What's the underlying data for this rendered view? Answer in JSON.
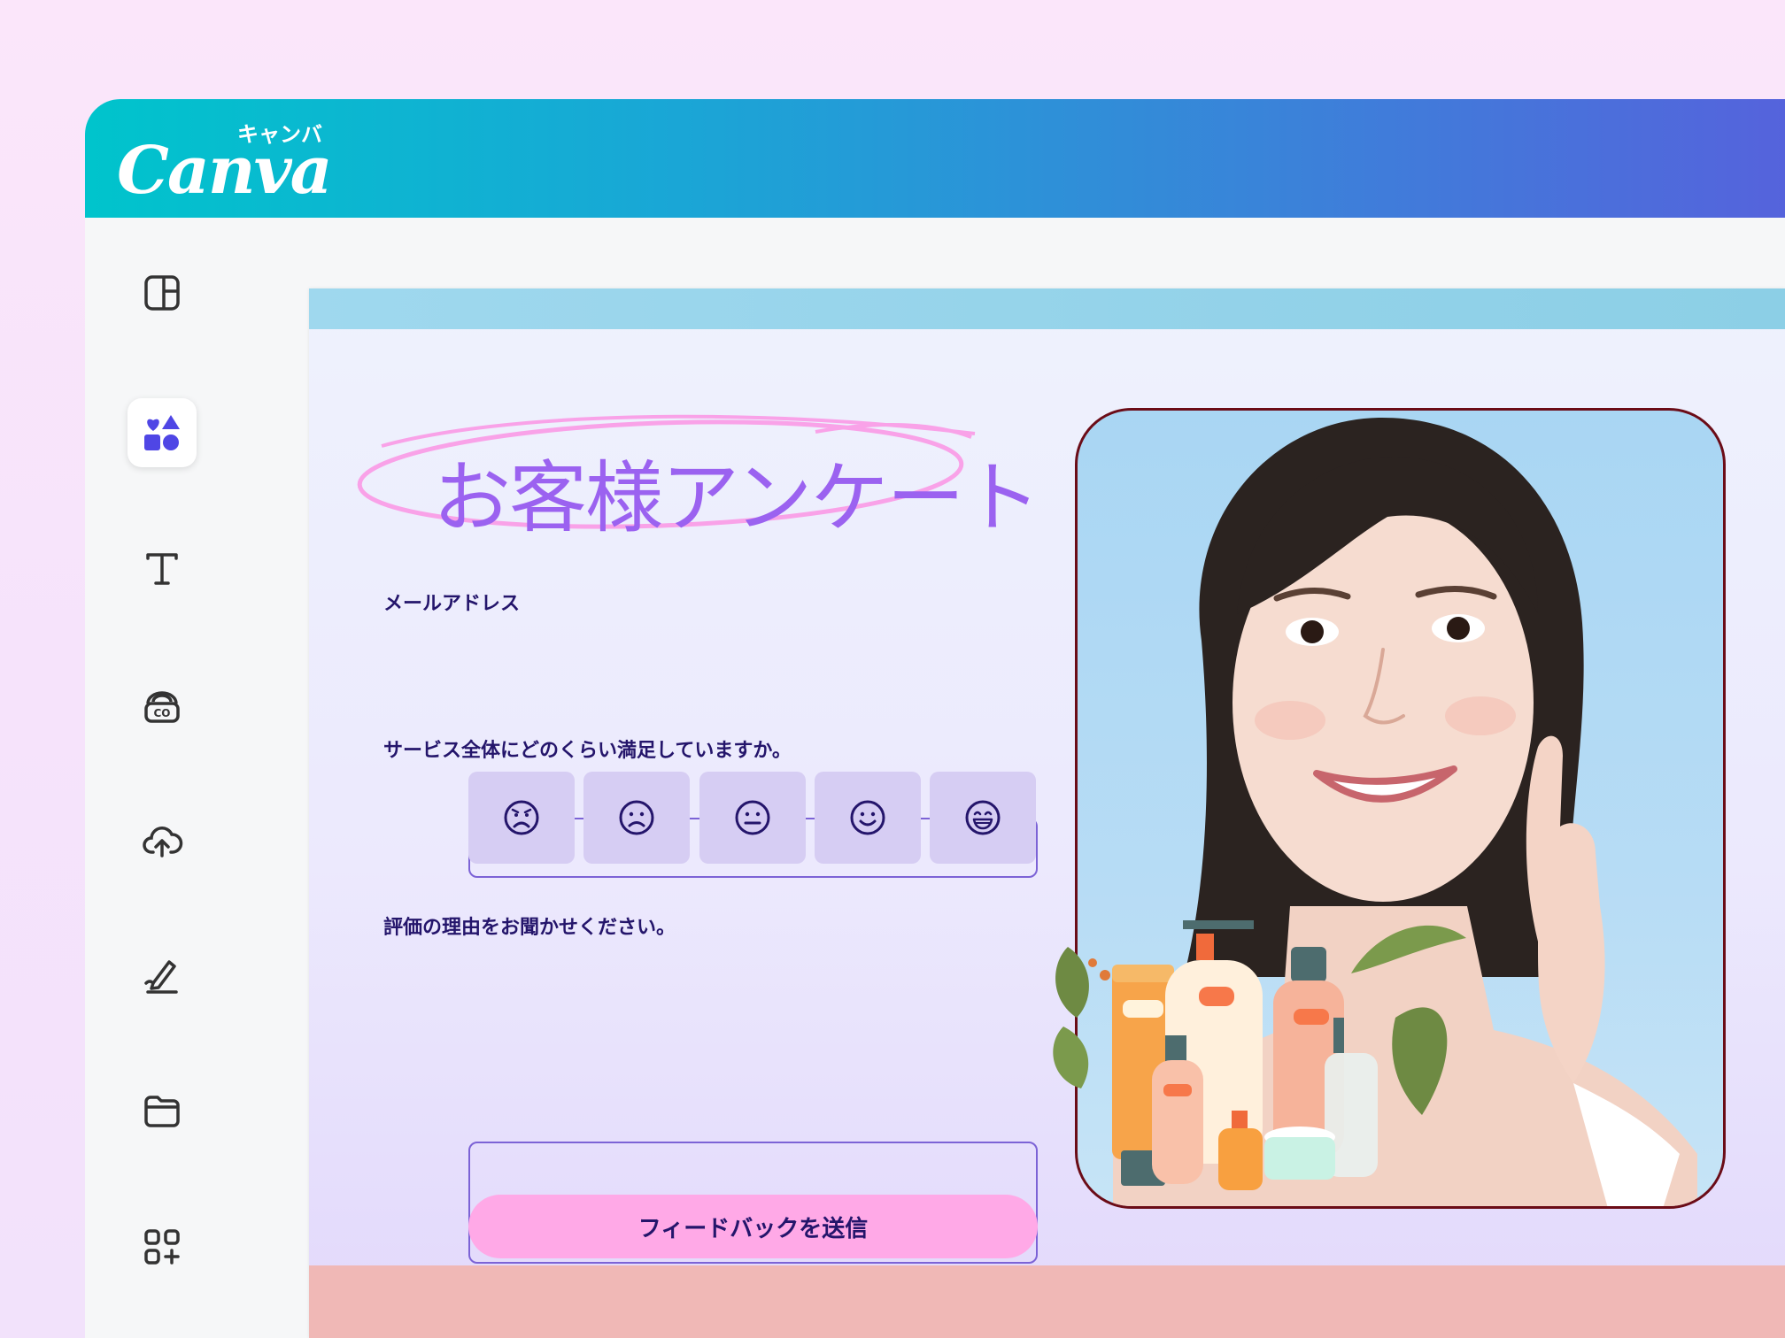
{
  "app": {
    "logo_word": "Canva",
    "logo_kana": "キャンバ",
    "topbar_gradient": [
      "#00c4cc",
      "#5563dc"
    ]
  },
  "sidebar": {
    "items": [
      {
        "name": "design",
        "icon": "layout-panel-icon",
        "active": false
      },
      {
        "name": "elements",
        "icon": "shapes-icon",
        "active": true
      },
      {
        "name": "text",
        "icon": "text-icon",
        "active": false
      },
      {
        "name": "brand",
        "icon": "brand-kit-icon",
        "active": false
      },
      {
        "name": "uploads",
        "icon": "cloud-upload-icon",
        "active": false
      },
      {
        "name": "draw",
        "icon": "draw-pen-icon",
        "active": false
      },
      {
        "name": "projects",
        "icon": "folder-icon",
        "active": false
      },
      {
        "name": "apps",
        "icon": "apps-grid-plus-icon",
        "active": false
      }
    ]
  },
  "form": {
    "title": "お客様アンケート",
    "email_label": "メールアドレス",
    "email_value": "",
    "satisfaction_label": "サービス全体にどのくらい満足していますか。",
    "ratings": [
      {
        "icon": "very-sad-face-icon"
      },
      {
        "icon": "sad-face-icon"
      },
      {
        "icon": "neutral-face-icon"
      },
      {
        "icon": "smile-face-icon"
      },
      {
        "icon": "grin-face-icon"
      }
    ],
    "reason_label": "評価の理由をお聞かせください。",
    "reason_value": "",
    "submit_label": "フィードバックを送信"
  },
  "colors": {
    "title": "#9b62f0",
    "label": "#24156b",
    "submit_bg": "#ffa9e7",
    "rating_bg": "#d6cdf3",
    "photo_border": "#6b0c17"
  }
}
